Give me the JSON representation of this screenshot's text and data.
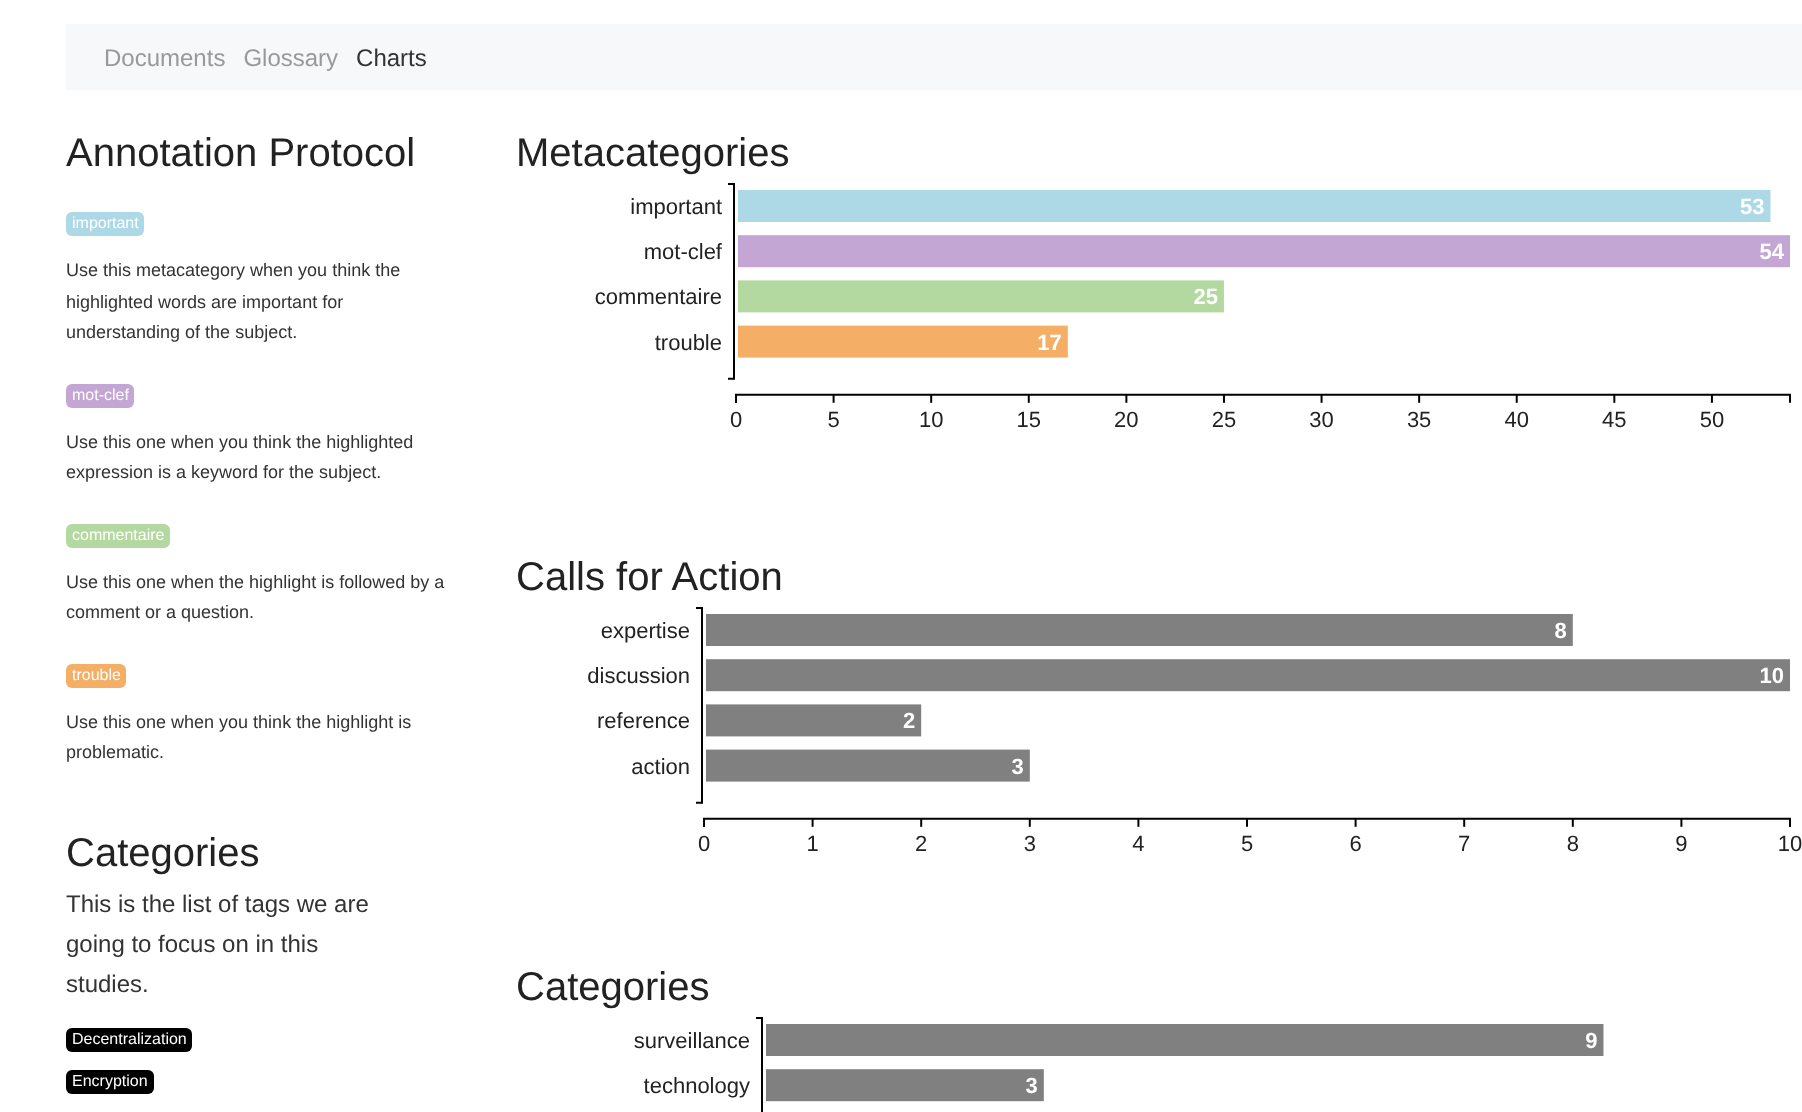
{
  "nav": [
    {
      "label": "Documents",
      "selected": false
    },
    {
      "label": "Glossary",
      "selected": false
    },
    {
      "label": "Charts",
      "selected": true
    }
  ],
  "protocol": {
    "title": "Annotation Protocol",
    "items": [
      {
        "tag": "important",
        "color": "#add8e6",
        "description": "Use this metacategory when you think the highlighted words are important for understanding of the subject."
      },
      {
        "tag": "mot-clef",
        "color": "#c3a6d3",
        "description": "Use this one when you think the highlighted expression is a keyword for the subject."
      },
      {
        "tag": "commentaire",
        "color": "#b3d9a0",
        "description": "Use this one when the highlight is followed by a comment or a question."
      },
      {
        "tag": "trouble",
        "color": "#f4ae66",
        "description": "Use this one when you think the highlight is problematic."
      }
    ]
  },
  "categories_panel": {
    "title": "Categories",
    "description": "This is the list of tags we are going to focus on in this studies.",
    "tags": [
      "Decentralization",
      "Encryption"
    ]
  },
  "charts": [
    {
      "title": "Metacategories",
      "chart_data": {
        "type": "bar",
        "orientation": "horizontal",
        "stacked": true,
        "categories": [
          "important",
          "mot-clef",
          "commentaire",
          "trouble"
        ],
        "series": [
          {
            "color": "#add8e6",
            "values": [
              53,
              null,
              null,
              null
            ]
          },
          {
            "color": "#c3a6d3",
            "values": [
              null,
              54,
              null,
              null
            ]
          },
          {
            "color": "#b3d9a0",
            "values": [
              null,
              null,
              25,
              null
            ]
          },
          {
            "color": "#f4ae66",
            "values": [
              null,
              null,
              null,
              17
            ]
          }
        ],
        "xlim": [
          0,
          54
        ],
        "xticks": [
          0,
          5,
          10,
          15,
          20,
          25,
          30,
          35,
          40,
          45,
          50
        ],
        "data_labels": true
      }
    },
    {
      "title": "Calls for Action",
      "chart_data": {
        "type": "bar",
        "orientation": "horizontal",
        "categories": [
          "expertise",
          "discussion",
          "reference",
          "action"
        ],
        "series": [
          {
            "color": "#808080",
            "values": [
              8,
              10,
              2,
              3
            ]
          }
        ],
        "xlim": [
          0,
          10
        ],
        "xticks": [
          0,
          1,
          2,
          3,
          4,
          5,
          6,
          7,
          8,
          9,
          10
        ],
        "data_labels": true
      }
    },
    {
      "title": "Categories",
      "chart_data": {
        "type": "bar",
        "orientation": "horizontal",
        "categories": [
          "surveillance",
          "technology"
        ],
        "series": [
          {
            "color": "#808080",
            "values": [
              9,
              3
            ]
          }
        ],
        "data_labels": true
      }
    }
  ]
}
